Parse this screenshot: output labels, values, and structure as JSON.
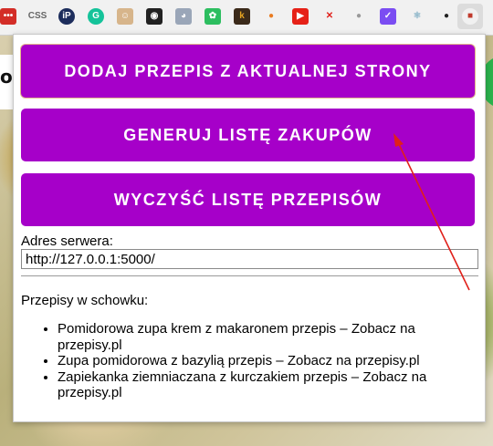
{
  "toolbar": {
    "icons": [
      {
        "name": "extension-lastpass",
        "text": "•••",
        "bg": "#d32d27"
      },
      {
        "name": "extension-css",
        "text": "CSS",
        "bg": "#f1f1f1",
        "fg": "#666"
      },
      {
        "name": "extension-ip",
        "text": "iP",
        "bg": "#1d2d5c"
      },
      {
        "name": "extension-grammarly",
        "text": "G",
        "bg": "#15c39a"
      },
      {
        "name": "extension-face",
        "text": "☺",
        "bg": "#d7b58b"
      },
      {
        "name": "extension-screenshot",
        "text": "◉",
        "bg": "#222"
      },
      {
        "name": "extension-owl",
        "text": "◕",
        "bg": "#9aa6b8"
      },
      {
        "name": "extension-evernote",
        "text": "✿",
        "bg": "#2dbe60"
      },
      {
        "name": "extension-k",
        "text": "k",
        "bg": "#3b2a1a",
        "fg": "#e6a321"
      },
      {
        "name": "extension-orange",
        "text": "●",
        "bg": "#f1f1f1",
        "fg": "#e97c22"
      },
      {
        "name": "extension-youtube",
        "text": "▶",
        "bg": "#e62117"
      },
      {
        "name": "extension-close-x",
        "text": "✕",
        "bg": "#f1f1f1",
        "fg": "#e0201a"
      },
      {
        "name": "extension-grey-dot",
        "text": "●",
        "bg": "#f1f1f1",
        "fg": "#9a9a9a"
      },
      {
        "name": "extension-purple-check",
        "text": "✓",
        "bg": "#7b4df2"
      },
      {
        "name": "extension-react",
        "text": "⚛",
        "bg": "#f1f1f1",
        "fg": "#8ab4c8"
      },
      {
        "name": "extension-github",
        "text": "●",
        "bg": "#f1f1f1",
        "fg": "#222"
      },
      {
        "name": "extension-recipes-active",
        "text": "■",
        "bg": "#f1f1f1",
        "fg": "#c0392b"
      }
    ]
  },
  "popup": {
    "buttons": {
      "add_recipe": "DODAJ PRZEPIS Z AKTUALNEJ STRONY",
      "generate_list": "GENERUJ LISTĘ ZAKUPÓW",
      "clear_list": "WYCZYŚĆ LISTĘ PRZEPISÓW"
    },
    "server": {
      "label": "Adres serwera:",
      "value": "http://127.0.0.1:5000/"
    },
    "clipboard": {
      "title": "Przepisy w schowku:",
      "recipes": [
        {
          "name": "Pomidorowa zupa krem z makaronem przepis",
          "sep": " – ",
          "link": "Zobacz na przepisy.pl"
        },
        {
          "name": "Zupa pomidorowa z bazylią przepis",
          "sep": " – ",
          "link": "Zobacz na przepisy.pl"
        },
        {
          "name": "Zapiekanka ziemniaczana z kurczakiem przepis",
          "sep": " – ",
          "link": "Zobacz na przepisy.pl"
        }
      ]
    }
  },
  "background_page": {
    "partial_letter": "o"
  },
  "colors": {
    "button_purple": "#a600c9",
    "annotation_red": "#e0201a"
  }
}
